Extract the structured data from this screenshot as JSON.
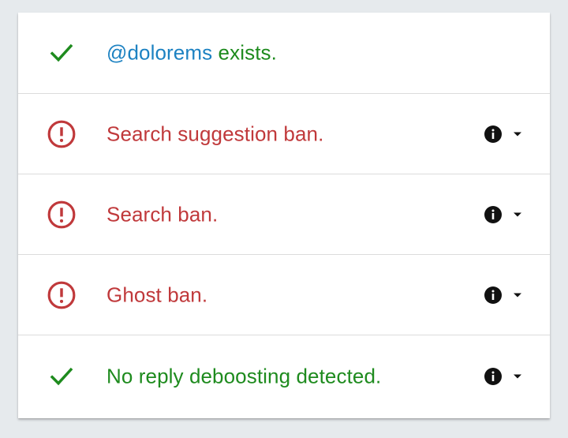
{
  "colors": {
    "ok": "#1e8b1e",
    "ban": "#c0393b",
    "handle": "#1d82c2",
    "background": "#e6eaed"
  },
  "rows": [
    {
      "status": "ok",
      "icon": "check-icon",
      "handle": "@dolorems",
      "text": " exists."
    },
    {
      "status": "ban",
      "icon": "alert-circle-icon",
      "text": "Search suggestion ban.",
      "actions": [
        "info-icon",
        "caret-down-icon"
      ]
    },
    {
      "status": "ban",
      "icon": "alert-circle-icon",
      "text": "Search ban.",
      "actions": [
        "info-icon",
        "caret-down-icon"
      ]
    },
    {
      "status": "ban",
      "icon": "alert-circle-icon",
      "text": "Ghost ban.",
      "actions": [
        "info-icon",
        "caret-down-icon"
      ]
    },
    {
      "status": "ok",
      "icon": "check-icon",
      "text": "No reply deboosting detected.",
      "actions": [
        "info-icon",
        "caret-down-icon"
      ]
    }
  ]
}
